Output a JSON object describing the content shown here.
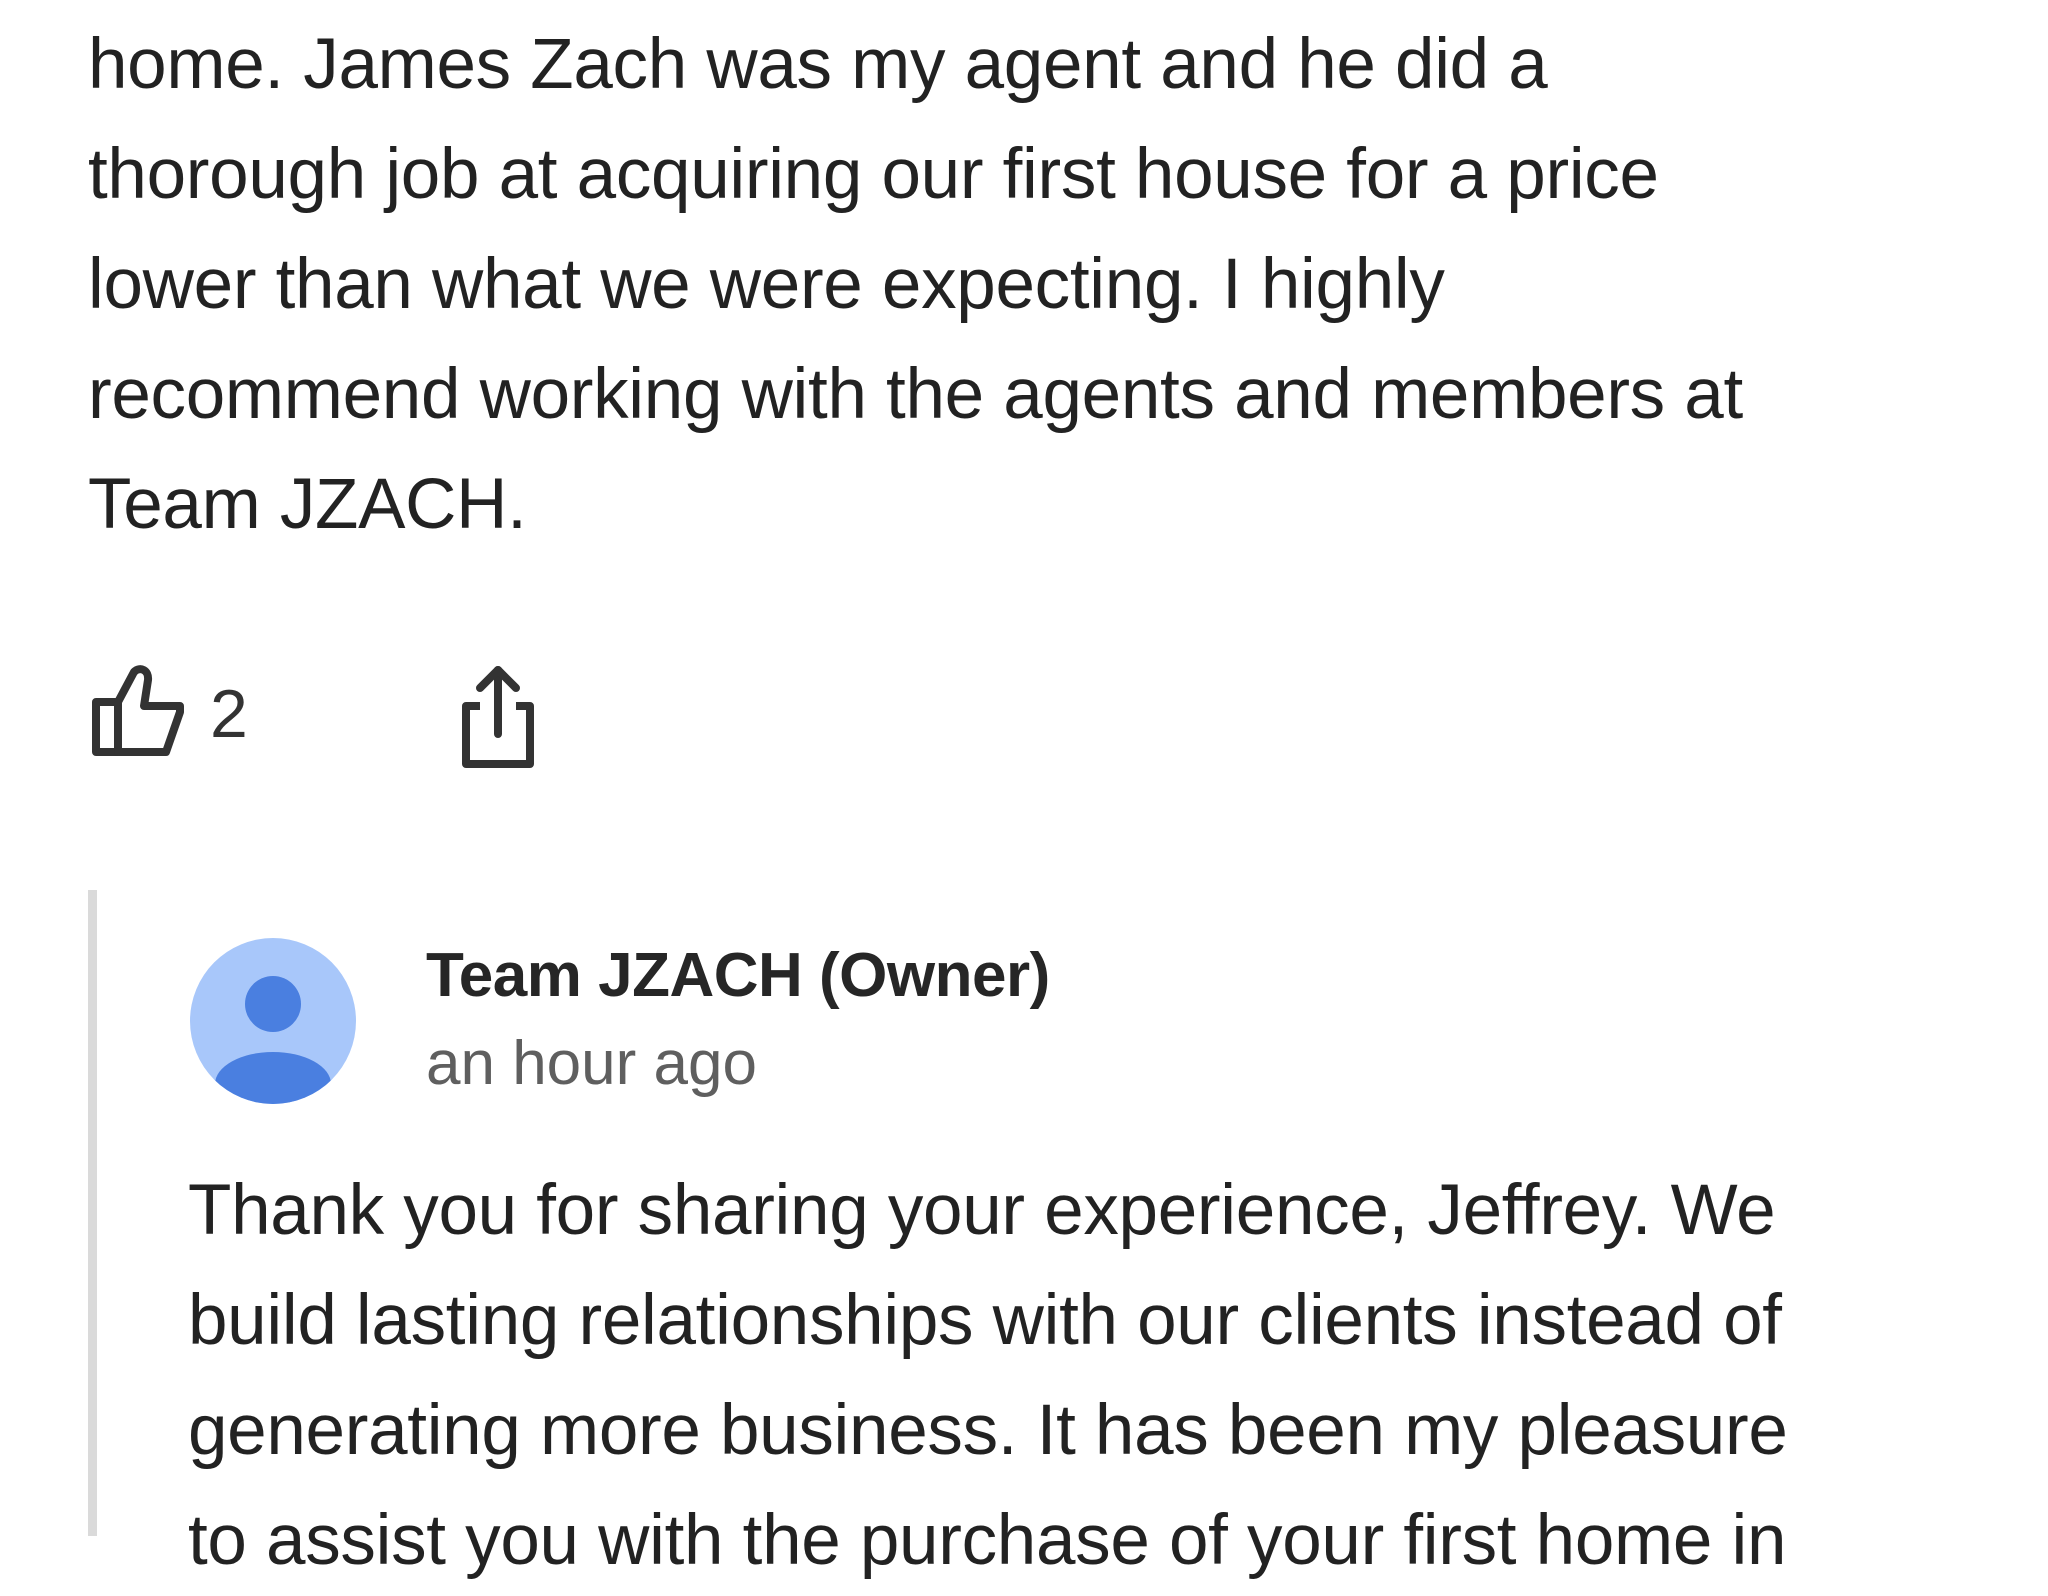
{
  "review": {
    "lines": [
      "home. James Zach was my agent and he did a",
      "thorough job at acquiring our first house for a price",
      "lower than what we were expecting. I highly",
      "recommend working with the agents and members at",
      "Team JZACH."
    ]
  },
  "actions": {
    "like_icon": "thumbs-up-icon",
    "like_count": "2",
    "share_icon": "share-icon"
  },
  "owner_reply": {
    "avatar_icon": "person-avatar-icon",
    "author": "Team JZACH (Owner)",
    "time": "an hour ago",
    "lines": [
      "Thank you for sharing your experience, Jeffrey. We",
      "build lasting relationships with our clients instead of",
      "generating more business. It has been my pleasure",
      "to assist you with the purchase of your first home in"
    ]
  },
  "colors": {
    "avatar_bg": "#a8c7fa",
    "avatar_fg": "#4a7fe0",
    "reply_bar": "#dadada",
    "text": "#222222",
    "secondary_text": "#5f5f5f"
  }
}
